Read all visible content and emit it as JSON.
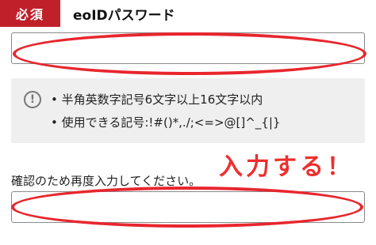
{
  "field": {
    "required_label": "必須",
    "title": "eoIDパスワード"
  },
  "hints": {
    "icon": "warning-circle-icon",
    "items": [
      "半角英数字記号6文字以上16文字以内",
      "使用できる記号:!#()*,./;<=>@[]^_{|}"
    ]
  },
  "confirm": {
    "label": "確認のため再度入力してください。"
  },
  "annotation": {
    "text": "入力する！",
    "color": "#ee2e2e"
  },
  "colors": {
    "required_badge": "#c0202a",
    "hint_panel": "#efefef",
    "highlight_ellipse": "#e8262e"
  }
}
